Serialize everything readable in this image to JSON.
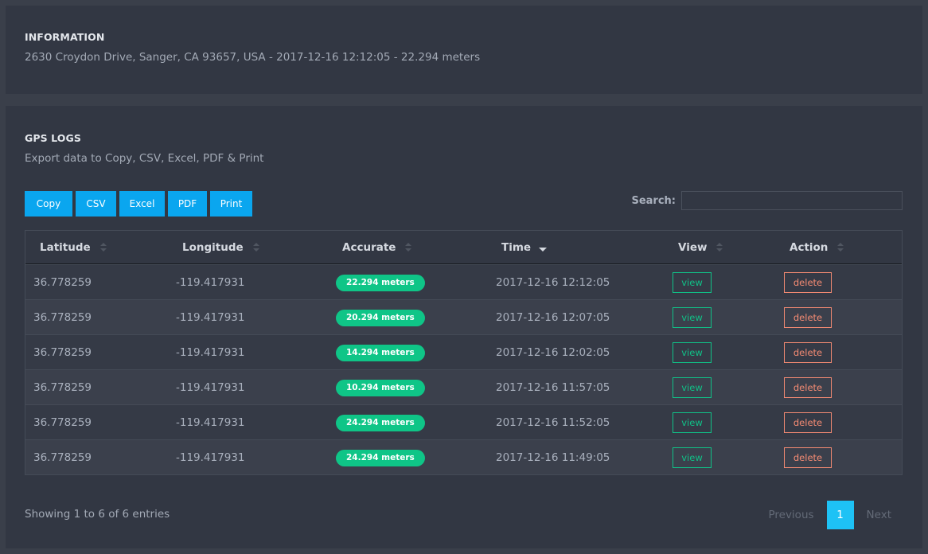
{
  "info": {
    "title": "INFORMATION",
    "text": "2630 Croydon Drive, Sanger, CA 93657, USA - 2017-12-16 12:12:05 - 22.294 meters"
  },
  "logs": {
    "title": "GPS LOGS",
    "subtitle": "Export data to Copy, CSV, Excel, PDF & Print",
    "buttons": [
      "Copy",
      "CSV",
      "Excel",
      "PDF",
      "Print"
    ],
    "search_label": "Search:",
    "search_value": "",
    "columns": [
      "Latitude",
      "Longitude",
      "Accurate",
      "Time",
      "View",
      "Action"
    ],
    "sorted_column": "Time",
    "rows": [
      {
        "latitude": "36.778259",
        "longitude": "-119.417931",
        "accurate": "22.294 meters",
        "time": "2017-12-16 12:12:05",
        "view": "view",
        "action": "delete"
      },
      {
        "latitude": "36.778259",
        "longitude": "-119.417931",
        "accurate": "20.294 meters",
        "time": "2017-12-16 12:07:05",
        "view": "view",
        "action": "delete"
      },
      {
        "latitude": "36.778259",
        "longitude": "-119.417931",
        "accurate": "14.294 meters",
        "time": "2017-12-16 12:02:05",
        "view": "view",
        "action": "delete"
      },
      {
        "latitude": "36.778259",
        "longitude": "-119.417931",
        "accurate": "10.294 meters",
        "time": "2017-12-16 11:57:05",
        "view": "view",
        "action": "delete"
      },
      {
        "latitude": "36.778259",
        "longitude": "-119.417931",
        "accurate": "24.294 meters",
        "time": "2017-12-16 11:52:05",
        "view": "view",
        "action": "delete"
      },
      {
        "latitude": "36.778259",
        "longitude": "-119.417931",
        "accurate": "24.294 meters",
        "time": "2017-12-16 11:49:05",
        "view": "view",
        "action": "delete"
      }
    ],
    "footer": "Showing 1 to 6 of 6 entries",
    "pagination": {
      "previous": "Previous",
      "current": "1",
      "next": "Next"
    }
  },
  "colors": {
    "accent": "#0aa6ef",
    "badge": "#0fc587",
    "view": "#10c187",
    "delete": "#f58b73",
    "page_active": "#1ec2f5"
  }
}
